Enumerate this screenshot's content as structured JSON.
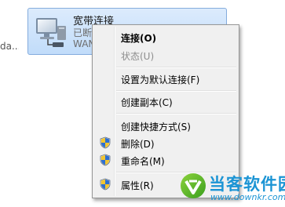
{
  "background_fragment": "da...",
  "connection": {
    "name": "宽带连接",
    "status": "已断开",
    "device": "WAN Miniport (PPPOE)",
    "icon": "network-computer-icon"
  },
  "context_menu": {
    "items": [
      {
        "label": "连接(O)",
        "bold": true,
        "disabled": false,
        "shield": false
      },
      {
        "label": "状态(U)",
        "bold": false,
        "disabled": true,
        "shield": false
      },
      {
        "label": "设置为默认连接(F)",
        "bold": false,
        "disabled": false,
        "shield": false
      },
      {
        "label": "创建副本(C)",
        "bold": false,
        "disabled": false,
        "shield": false
      },
      {
        "label": "创建快捷方式(S)",
        "bold": false,
        "disabled": false,
        "shield": false
      },
      {
        "label": "删除(D)",
        "bold": false,
        "disabled": false,
        "shield": true
      },
      {
        "label": "重命名(M)",
        "bold": false,
        "disabled": false,
        "shield": true
      },
      {
        "label": "属性(R)",
        "bold": false,
        "disabled": false,
        "shield": true
      }
    ],
    "shield_icon": "uac-shield-icon"
  },
  "watermark": {
    "title": "当客软件园",
    "url": "www.downkr.com",
    "color": "#1b94d4",
    "logo": "downkr-logo-icon"
  }
}
